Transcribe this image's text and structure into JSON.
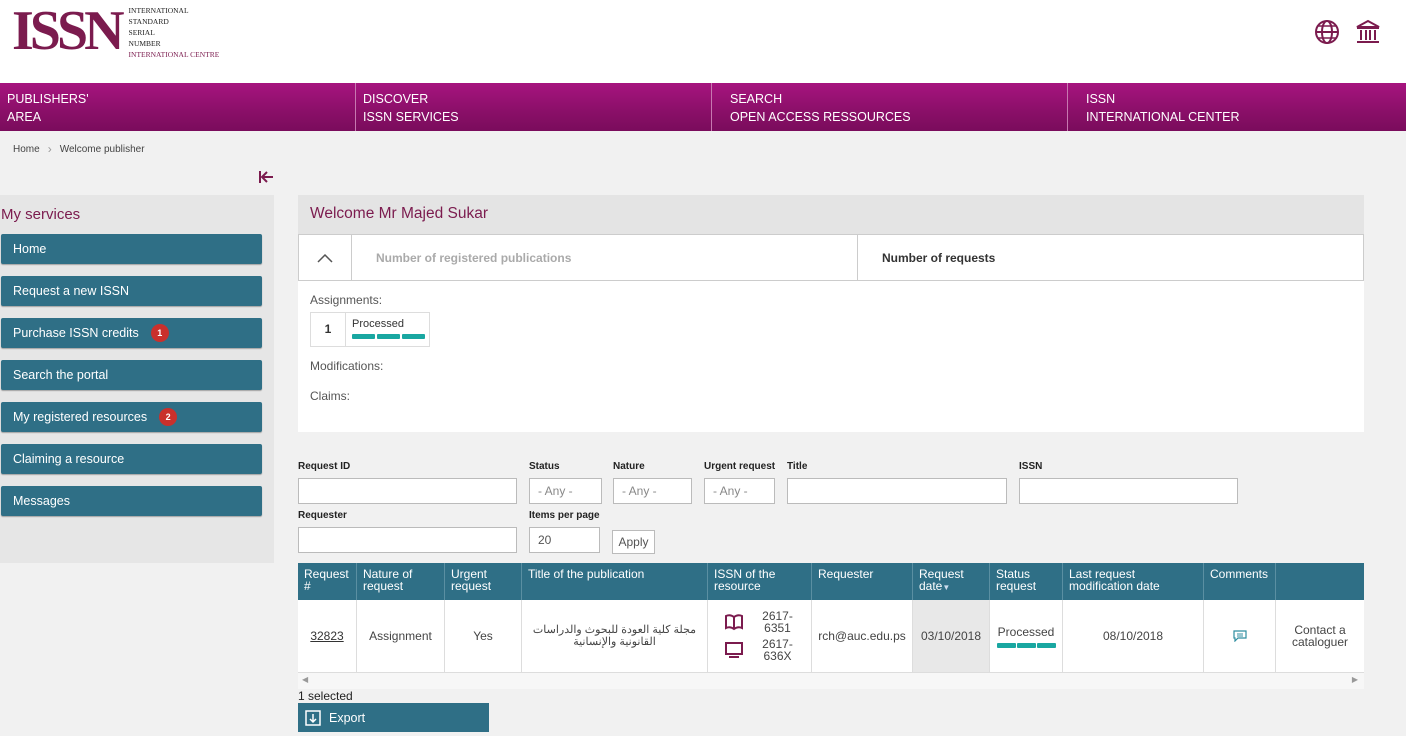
{
  "logo": {
    "mark": "ISSN",
    "lines": [
      "INTERNATIONAL",
      "STANDARD",
      "SERIAL",
      "NUMBER",
      "INTERNATIONAL CENTRE"
    ]
  },
  "nav": [
    {
      "line1": "PUBLISHERS'",
      "line2": "AREA"
    },
    {
      "line1": "DISCOVER",
      "line2": "ISSN SERVICES"
    },
    {
      "line1": "SEARCH",
      "line2": "OPEN ACCESS RESSOURCES"
    },
    {
      "line1": "ISSN",
      "line2": "INTERNATIONAL CENTER"
    }
  ],
  "breadcrumb": {
    "home": "Home",
    "current": "Welcome publisher"
  },
  "sidebar": {
    "title": "My services",
    "items": [
      {
        "label": "Home",
        "badge": ""
      },
      {
        "label": "Request a new ISSN",
        "badge": ""
      },
      {
        "label": "Purchase ISSN credits",
        "badge": "1"
      },
      {
        "label": "Search the portal",
        "badge": ""
      },
      {
        "label": "My registered resources",
        "badge": "2"
      },
      {
        "label": "Claiming a resource",
        "badge": ""
      },
      {
        "label": "Messages",
        "badge": ""
      }
    ]
  },
  "welcome": {
    "title": "Welcome Mr Majed Sukar",
    "tabs": [
      "Number of registered publications",
      "Number of requests"
    ],
    "assignments_label": "Assignments:",
    "assignment_count": "1",
    "assignment_status": "Processed",
    "modifications_label": "Modifications:",
    "claims_label": "Claims:"
  },
  "filters": {
    "request_id": "Request ID",
    "status": "Status",
    "nature": "Nature",
    "urgent": "Urgent request",
    "title": "Title",
    "issn": "ISSN",
    "requester": "Requester",
    "items_per_page": "Items per page",
    "any": "- Any -",
    "items_value": "20",
    "apply": "Apply"
  },
  "table": {
    "headers": [
      "Request #",
      "Nature of request",
      "Urgent request",
      "Title of the publication",
      "ISSN of the resource",
      "Requester",
      "Request date",
      "Status request",
      "Last request modification date",
      "Comments",
      ""
    ],
    "row": {
      "id": "32823",
      "nature": "Assignment",
      "urgent": "Yes",
      "title": "مجلة كلية العودة للبحوث والدراسات القانونية والإنسانية",
      "issn_print": "2617-6351",
      "issn_online": "2617-636X",
      "requester": "rch@auc.edu.ps",
      "date": "03/10/2018",
      "status": "Processed",
      "last_mod": "08/10/2018",
      "action": "Contact a cataloguer"
    }
  },
  "footer": {
    "selected": "1 selected",
    "export": "Export"
  },
  "colors": {
    "brand": "#7b1b4e",
    "nav": "#a7147f",
    "teal": "#2f6f86",
    "progress": "#19a7a1",
    "badge": "#c9302c"
  }
}
